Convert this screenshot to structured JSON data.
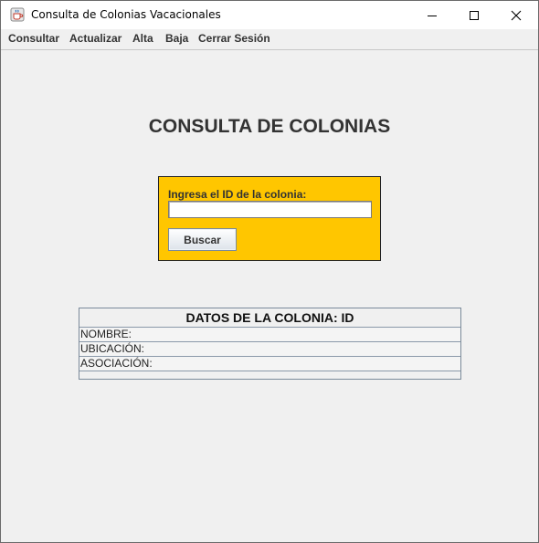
{
  "window": {
    "title": "Consulta de Colonias Vacacionales"
  },
  "menu": {
    "items": [
      "Consultar",
      "Actualizar",
      "Alta",
      "Baja",
      "Cerrar Sesión"
    ]
  },
  "page": {
    "heading": "CONSULTA DE COLONIAS"
  },
  "search": {
    "label": "Ingresa el ID de la colonia:",
    "value": "",
    "button_label": "Buscar"
  },
  "details": {
    "header": "DATOS DE LA COLONIA: ID",
    "rows": [
      "NOMBRE:",
      "UBICACIÓN:",
      "ASOCIACIÓN:"
    ]
  },
  "colors": {
    "panel_accent": "#ffc600",
    "background": "#f0f0f0"
  }
}
